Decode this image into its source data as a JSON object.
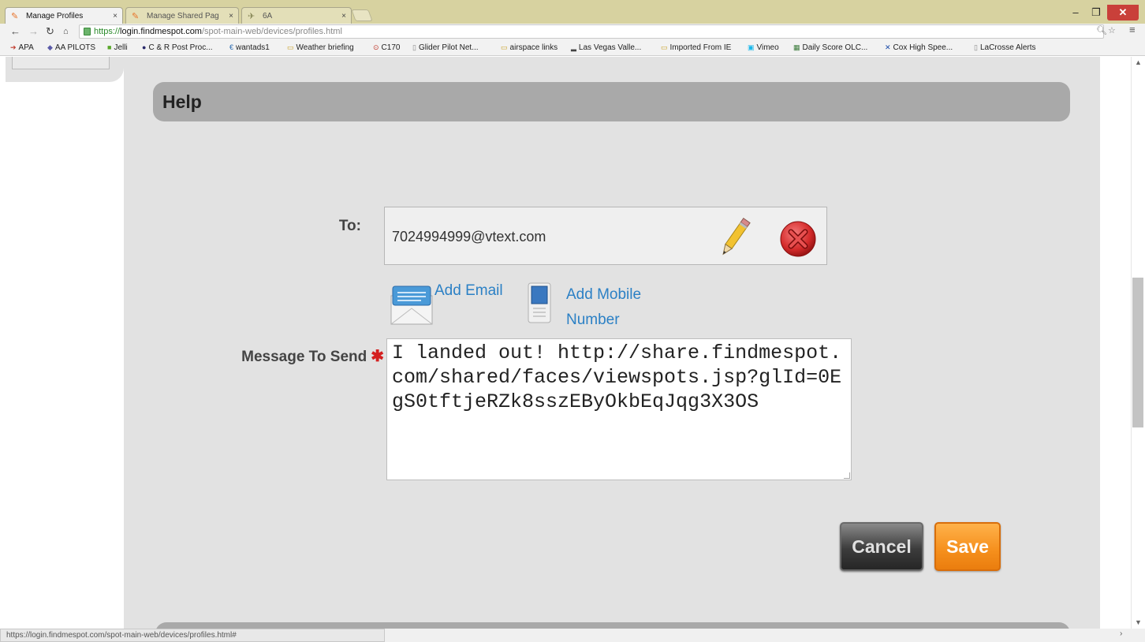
{
  "browser": {
    "tabs": [
      {
        "title": "Manage Profiles",
        "active": true
      },
      {
        "title": "Manage Shared Pag",
        "active": false
      },
      {
        "title": "6A",
        "active": false
      }
    ],
    "tab_close_glyph": "×",
    "window_controls": {
      "minimize": "–",
      "maximize": "❐",
      "close": "✕"
    },
    "url": {
      "scheme": "https://",
      "host": "login.findmespot.com",
      "path": "/spot-main-web/devices/profiles.html"
    },
    "bookmarks": [
      {
        "label": "APA",
        "icon": "arrow-icon"
      },
      {
        "label": "AA PILOTS",
        "icon": "diamond-icon"
      },
      {
        "label": "Jelli",
        "icon": "jelli-icon"
      },
      {
        "label": "C & R Post Proc...",
        "icon": "globe-icon"
      },
      {
        "label": "wantads1",
        "icon": "euro-icon"
      },
      {
        "label": "Weather briefing",
        "icon": "folder-icon"
      },
      {
        "label": "C170",
        "icon": "target-icon"
      },
      {
        "label": "Glider Pilot Net...",
        "icon": "page-icon"
      },
      {
        "label": "airspace links",
        "icon": "folder-icon"
      },
      {
        "label": "Las Vegas Valle...",
        "icon": "chart-icon"
      },
      {
        "label": "Imported From IE",
        "icon": "folder-icon"
      },
      {
        "label": "Vimeo",
        "icon": "vimeo-icon"
      },
      {
        "label": "Daily Score OLC...",
        "icon": "olc-icon"
      },
      {
        "label": "Cox High Spee...",
        "icon": "cox-icon"
      },
      {
        "label": "LaCrosse Alerts",
        "icon": "page-icon"
      }
    ],
    "status_url": "https://login.findmespot.com/spot-main-web/devices/profiles.html#"
  },
  "page": {
    "section_title": "Help",
    "to_label": "To:",
    "to_value": "7024994999@vtext.com",
    "add_email_label": "Add Email",
    "add_mobile_label": "Add Mobile Number",
    "message_label": "Message To Send",
    "required_marker": "✱",
    "message_value": "I landed out! http://share.findmespot.com/shared/faces/viewspots.jsp?glId=0EgS0tftjeRZk8sszEByOkbEqJqg3X3OS",
    "cancel_label": "Cancel",
    "save_label": "Save"
  },
  "colors": {
    "link": "#2b80c5",
    "save": "#f58f1c",
    "cancel": "#3c3c3c",
    "required": "#d42020",
    "header_bar": "#a9a9a9",
    "content_bg": "#e2e2e2"
  }
}
